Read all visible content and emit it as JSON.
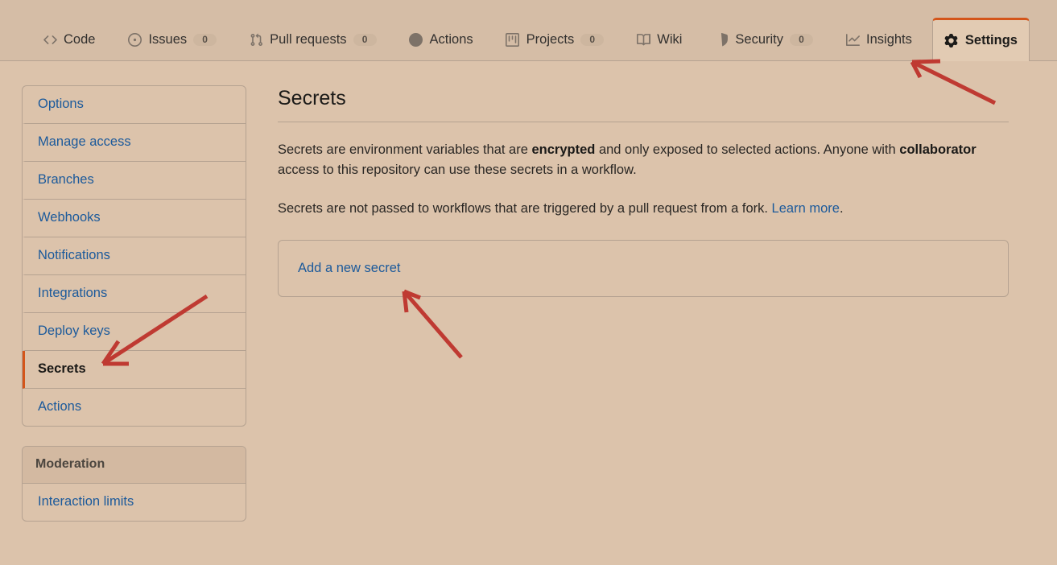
{
  "repo_nav": {
    "tabs": [
      {
        "label": "Code",
        "icon": "code-icon",
        "count": null,
        "active": false
      },
      {
        "label": "Issues",
        "icon": "issue-icon",
        "count": "0",
        "active": false
      },
      {
        "label": "Pull requests",
        "icon": "git-pull-request-icon",
        "count": "0",
        "active": false
      },
      {
        "label": "Actions",
        "icon": "play-icon",
        "count": null,
        "active": false
      },
      {
        "label": "Projects",
        "icon": "project-icon",
        "count": "0",
        "active": false
      },
      {
        "label": "Wiki",
        "icon": "book-icon",
        "count": null,
        "active": false
      },
      {
        "label": "Security",
        "icon": "shield-icon",
        "count": "0",
        "active": false
      },
      {
        "label": "Insights",
        "icon": "graph-icon",
        "count": null,
        "active": false
      },
      {
        "label": "Settings",
        "icon": "gear-icon",
        "count": null,
        "active": true
      }
    ]
  },
  "sidebar": {
    "groups": [
      {
        "header": null,
        "items": [
          {
            "label": "Options",
            "selected": false
          },
          {
            "label": "Manage access",
            "selected": false
          },
          {
            "label": "Branches",
            "selected": false
          },
          {
            "label": "Webhooks",
            "selected": false
          },
          {
            "label": "Notifications",
            "selected": false
          },
          {
            "label": "Integrations",
            "selected": false
          },
          {
            "label": "Deploy keys",
            "selected": false
          },
          {
            "label": "Secrets",
            "selected": true
          },
          {
            "label": "Actions",
            "selected": false
          }
        ]
      },
      {
        "header": "Moderation",
        "items": [
          {
            "label": "Interaction limits",
            "selected": false
          }
        ]
      }
    ]
  },
  "main": {
    "title": "Secrets",
    "paragraph1": {
      "part1": "Secrets are environment variables that are ",
      "bold1": "encrypted",
      "part2": " and only exposed to selected actions. Anyone with ",
      "bold2": "collaborator",
      "part3": " access to this repository can use these secrets in a workflow."
    },
    "paragraph2": {
      "part1": "Secrets are not passed to workflows that are triggered by a pull request from a fork. ",
      "link": "Learn more",
      "part2": "."
    },
    "add_secret_label": "Add a new secret"
  },
  "colors": {
    "page_background": "#dcc3ab",
    "nav_background": "#d5bda6",
    "accent_orange": "#d4551a",
    "link_blue": "#1c5a9b",
    "border": "#b5a291",
    "annotation_red": "#bf3a32"
  },
  "annotations": [
    {
      "name": "arrow-to-settings-tab",
      "points_to": "Settings"
    },
    {
      "name": "arrow-to-secrets-item",
      "points_to": "Secrets"
    },
    {
      "name": "arrow-to-add-new-secret",
      "points_to": "Add a new secret"
    }
  ]
}
